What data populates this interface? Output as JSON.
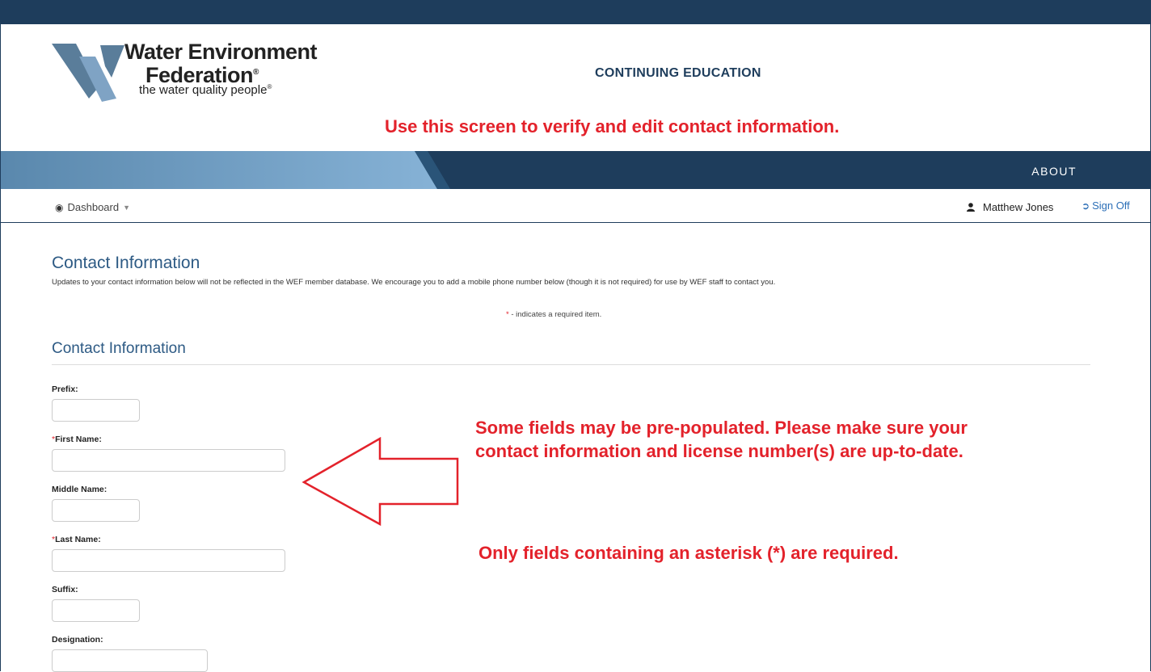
{
  "header": {
    "logo": {
      "name_line1": "Water Environment",
      "name_line2": "Federation",
      "reg_mark": "®",
      "tagline": "the water quality people",
      "tagline_mark": "®"
    },
    "title": "CONTINUING EDUCATION"
  },
  "annotations": {
    "top": "Use this screen to verify and edit contact information.",
    "middle_line1": "Some fields may be pre-populated. Please make sure your",
    "middle_line2": "contact information and license number(s) are up-to-date.",
    "bottom": "Only fields containing an asterisk (*) are required."
  },
  "nav": {
    "about": "ABOUT",
    "dashboard": "Dashboard",
    "user_name": "Matthew Jones",
    "sign_off": "Sign Off"
  },
  "page": {
    "heading": "Contact Information",
    "description": "Updates to your contact information below will not be reflected in the WEF member database. We encourage you to add a mobile phone number below (though it is not required) for use by WEF staff to contact you.",
    "required_star": "*",
    "required_note": " - indicates a required item.",
    "section_heading": "Contact Information"
  },
  "form": {
    "fields": [
      {
        "label": "Prefix:",
        "required": false,
        "value": ""
      },
      {
        "label": "First Name:",
        "required": true,
        "value": ""
      },
      {
        "label": "Middle Name:",
        "required": false,
        "value": ""
      },
      {
        "label": "Last Name:",
        "required": true,
        "value": ""
      },
      {
        "label": "Suffix:",
        "required": false,
        "value": ""
      },
      {
        "label": "Designation:",
        "required": false,
        "value": ""
      }
    ],
    "star": "*"
  },
  "colors": {
    "navy": "#1e3d5c",
    "annotation_red": "#e3222b",
    "heading_blue": "#2d5a84",
    "link_blue": "#2c6fb7"
  }
}
